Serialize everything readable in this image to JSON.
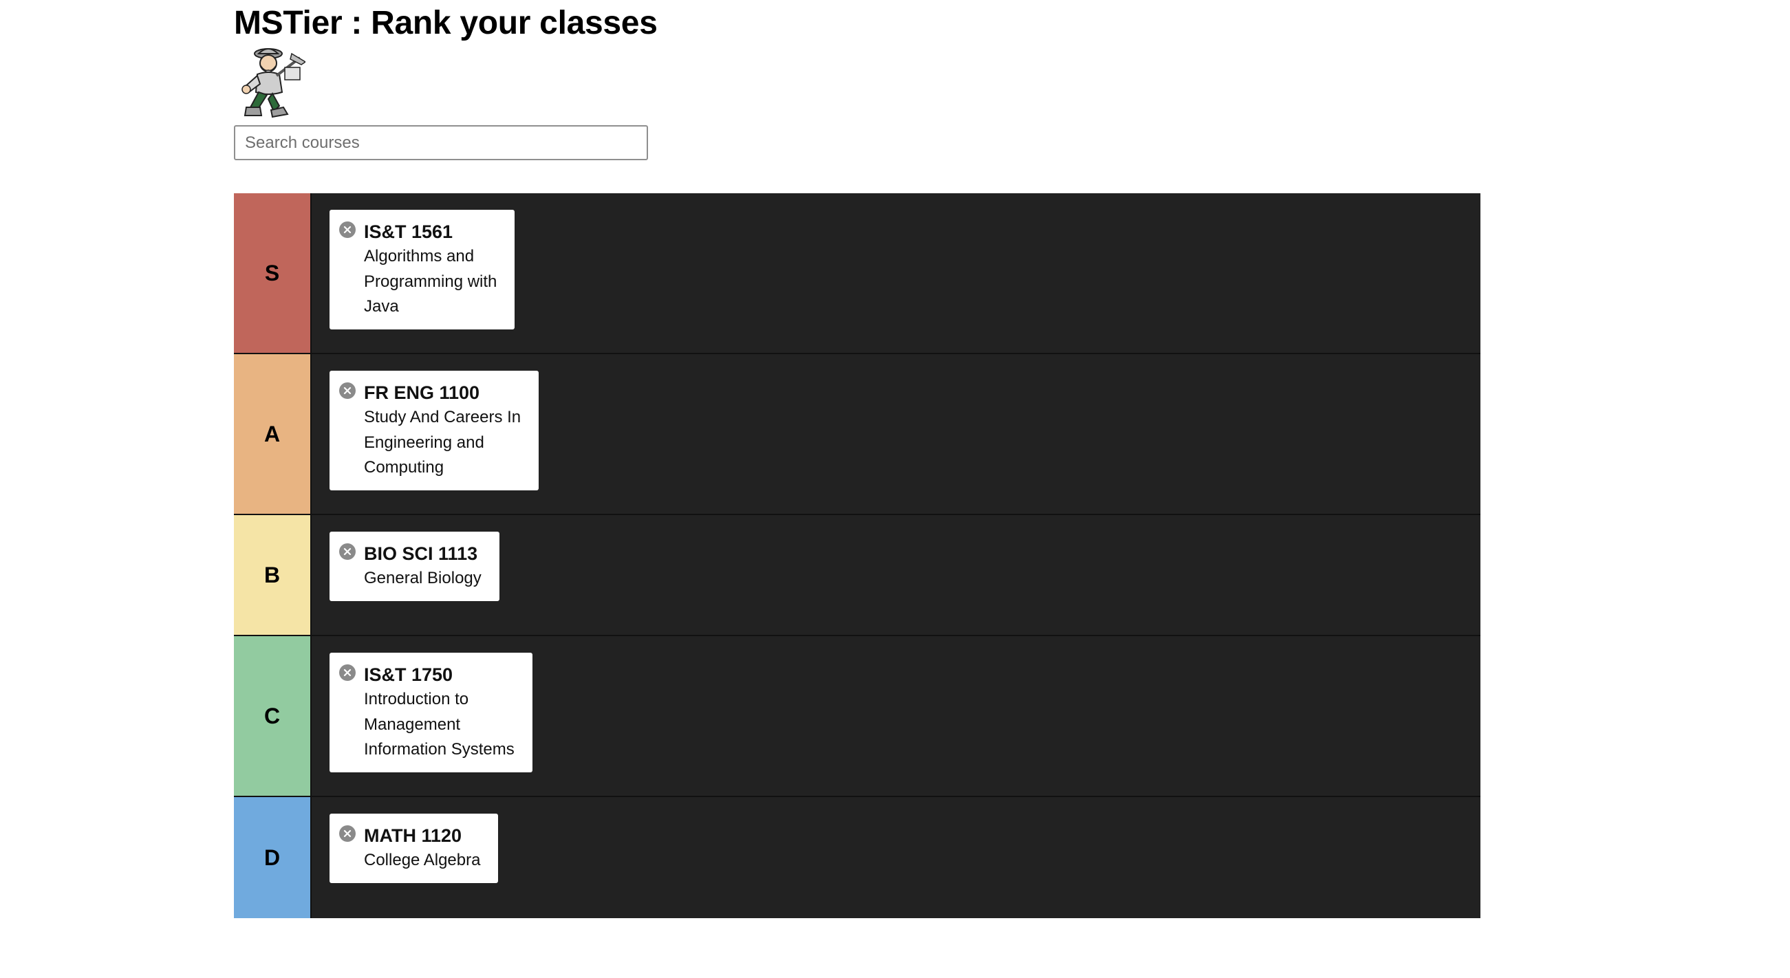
{
  "header": {
    "title": "MSTier : Rank your classes",
    "mascot_icon": "miner-mascot-logo"
  },
  "search": {
    "placeholder": "Search courses",
    "value": ""
  },
  "tiers": [
    {
      "label": "S",
      "color": "#c0665b",
      "courses": [
        {
          "code": "IS&T 1561",
          "name_lines": [
            "Algorithms and",
            "Programming with",
            "Java"
          ]
        }
      ]
    },
    {
      "label": "A",
      "color": "#e8b482",
      "courses": [
        {
          "code": "FR ENG 1100",
          "name_lines": [
            "Study And Careers In",
            "Engineering and",
            "Computing"
          ]
        }
      ]
    },
    {
      "label": "B",
      "color": "#f5e4a6",
      "courses": [
        {
          "code": "BIO SCI 1113",
          "name_lines": [
            "General Biology"
          ]
        }
      ]
    },
    {
      "label": "C",
      "color": "#92cba0",
      "courses": [
        {
          "code": "IS&T 1750",
          "name_lines": [
            "Introduction to",
            "Management",
            "Information Systems"
          ]
        }
      ]
    },
    {
      "label": "D",
      "color": "#70aade",
      "courses": [
        {
          "code": "MATH 1120",
          "name_lines": [
            "College Algebra"
          ]
        }
      ]
    }
  ],
  "icons": {
    "remove": "close-circle-icon"
  },
  "colors": {
    "board_background": "#222222",
    "card_background": "#ffffff",
    "remove_icon": "#8a8a8a"
  }
}
